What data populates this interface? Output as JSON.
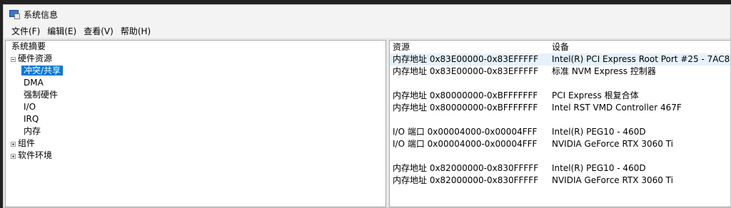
{
  "window": {
    "title": "系统信息"
  },
  "menu": [
    "文件(F)",
    "编辑(E)",
    "查看(V)",
    "帮助(H)"
  ],
  "tree": {
    "root": "系统摘要",
    "hardware": "硬件资源",
    "children": [
      "冲突/共享",
      "DMA",
      "强制硬件",
      "I/O",
      "IRQ",
      "内存"
    ],
    "selected": "冲突/共享",
    "components": "组件",
    "software": "软件环境"
  },
  "table": {
    "columns": [
      "资源",
      "设备"
    ],
    "groups": [
      [
        {
          "resource": "内存地址 0x83E00000-0x83EFFFFF",
          "device": "Intel(R) PCI Express Root Port #25 - 7AC8"
        },
        {
          "resource": "内存地址 0x83E00000-0x83EFFFFF",
          "device": "标准 NVM Express 控制器"
        }
      ],
      [
        {
          "resource": "内存地址 0x80000000-0xBFFFFFFF",
          "device": "PCI Express 根复合体"
        },
        {
          "resource": "内存地址 0x80000000-0xBFFFFFFF",
          "device": "Intel RST VMD Controller 467F"
        }
      ],
      [
        {
          "resource": "I/O 端口 0x00004000-0x00004FFF",
          "device": "Intel(R) PEG10 - 460D"
        },
        {
          "resource": "I/O 端口 0x00004000-0x00004FFF",
          "device": "NVIDIA GeForce RTX 3060 Ti"
        }
      ],
      [
        {
          "resource": "内存地址 0x82000000-0x830FFFFF",
          "device": "Intel(R) PEG10 - 460D"
        },
        {
          "resource": "内存地址 0x82000000-0x830FFFFF",
          "device": "NVIDIA GeForce RTX 3060 Ti"
        }
      ]
    ]
  }
}
